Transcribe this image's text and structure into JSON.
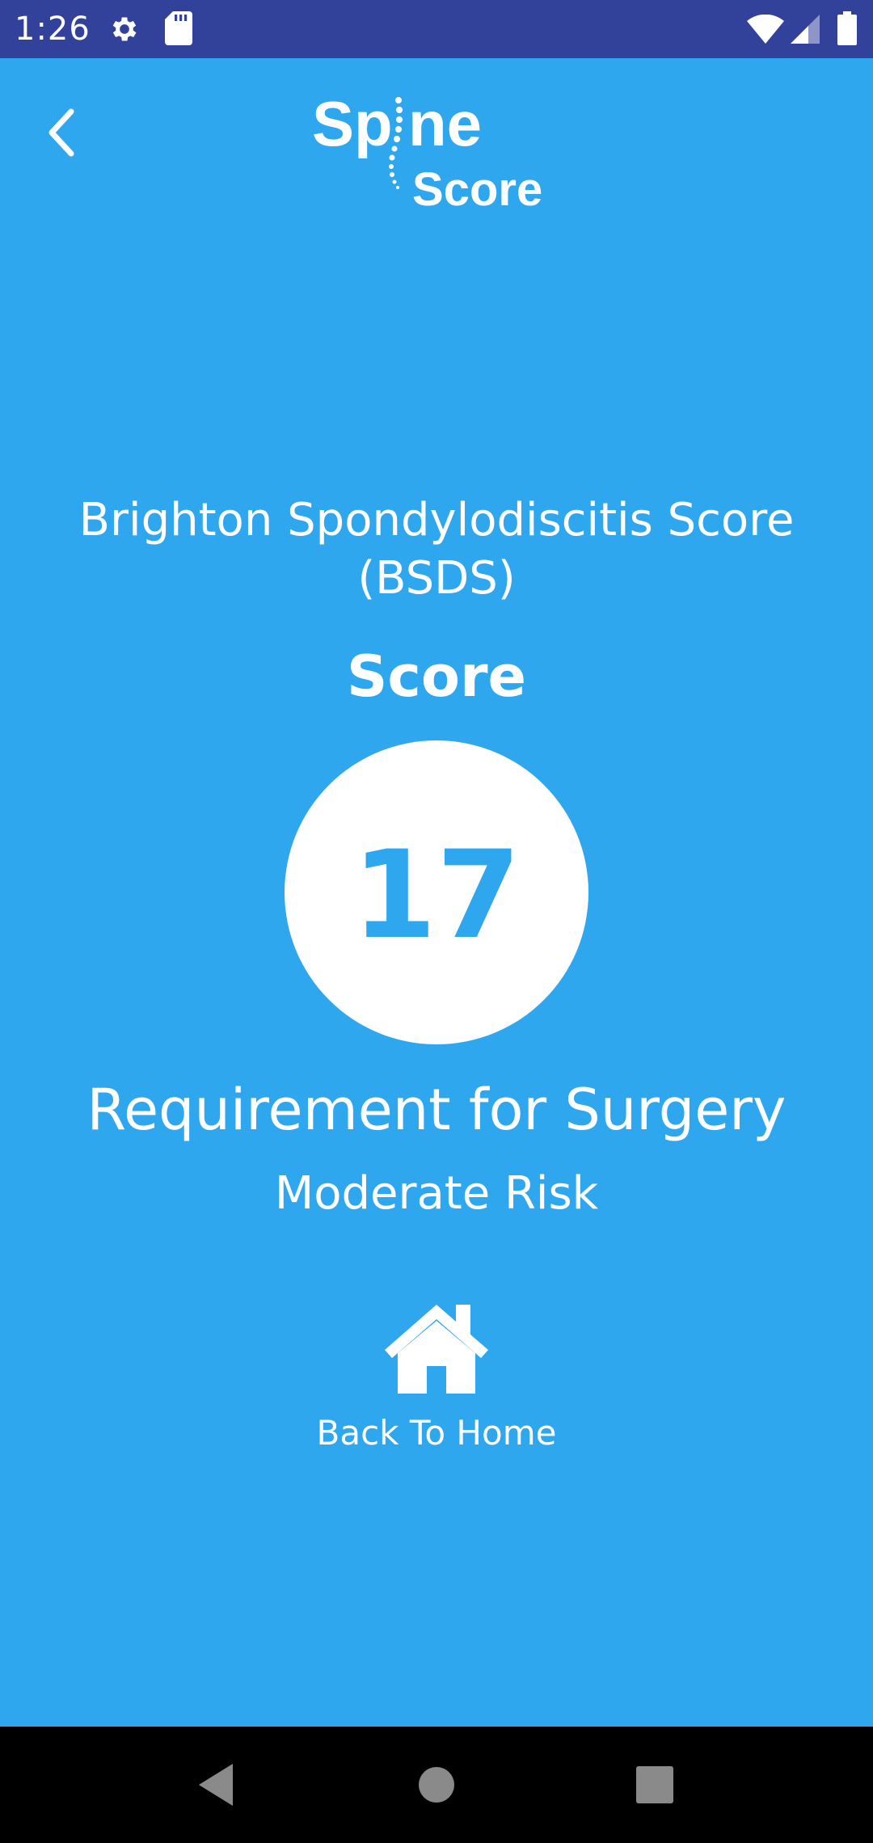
{
  "status_bar": {
    "time": "1:26",
    "icons": [
      "gear-icon",
      "sd-card-icon",
      "wifi-icon",
      "signal-icon",
      "battery-icon"
    ]
  },
  "header": {
    "back_icon": "chevron-left-icon",
    "logo_line1": "Spine",
    "logo_line2": "Score"
  },
  "result": {
    "calculator_title": "Brighton Spondylodiscitis Score (BSDS)",
    "score_heading": "Score",
    "score_value": "17",
    "result_title": "Requirement for Surgery",
    "risk_level": "Moderate Risk"
  },
  "actions": {
    "home_icon": "home-icon",
    "home_label": "Back To Home"
  },
  "nav_bar": {
    "icons": [
      "back-triangle-icon",
      "home-circle-icon",
      "recents-square-icon"
    ]
  },
  "colors": {
    "background": "#2ea7ee",
    "status_bar": "#32419a",
    "text": "#ffffff",
    "score_text": "#2ea7ee",
    "nav_bar": "#000000"
  }
}
